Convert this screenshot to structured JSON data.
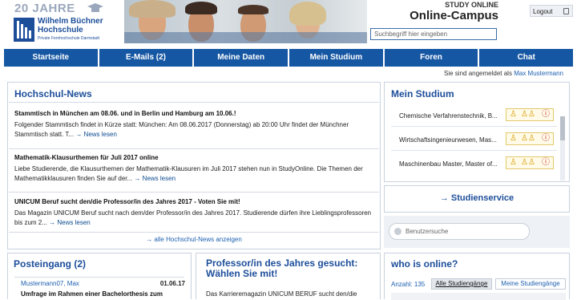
{
  "header": {
    "logo_jahre": "20 JAHRE",
    "logo_name1": "Wilhelm Büchner",
    "logo_name2": "Hochschule",
    "logo_sub": "Private Fernhochschule Darmstadt",
    "study_online": "STUDY ONLINE",
    "campus": "Online-Campus",
    "search_placeholder": "Suchbegriff hier eingeben",
    "logout": "Logout"
  },
  "nav": [
    "Startseite",
    "E-Mails (2)",
    "Meine Daten",
    "Mein Studium",
    "Foren",
    "Chat"
  ],
  "session": {
    "prefix": "Sie sind angemeldet als",
    "user": "Max Mustermann"
  },
  "news": {
    "title": "Hochschul-News",
    "items": [
      {
        "headline": "Stammtisch in München am 08.06. und in Berlin und Hamburg am 10.06.!",
        "text": "Folgender Stammtisch findet in Kürze statt: München: Am 08.06.2017 (Donnerstag) ab 20:00 Uhr findet der Münchner Stammtisch statt. T...",
        "more": "→ News lesen"
      },
      {
        "headline": "Mathematik-Klausurthemen für Juli 2017 online",
        "text": "Liebe Studierende, die Klausurthemen der Mathematik-Klausuren im Juli 2017 stehen nun in StudyOnline. Die Themen der Mathematikklausuren finden Sie auf der...",
        "more": "→ News lesen"
      },
      {
        "headline": "UNICUM Beruf sucht den/die Professor/in des Jahres 2017 - Voten Sie mit!",
        "text": "Das Magazin UNICUM Beruf sucht nach dem/der Professor/in des Jahres 2017. Studierende dürfen ihre Lieblingsprofessoren bis zum 2...",
        "more": "→ News lesen"
      }
    ],
    "all_link": "→ alle Hochschul-News anzeigen"
  },
  "studium": {
    "title": "Mein Studium",
    "courses": [
      "Chemische Verfahrenstechnik, B...",
      "Wirtschaftsingenieurwesen, Mas...",
      "Maschinenbau Master, Master of..."
    ]
  },
  "service": {
    "link": "→ Studienservice"
  },
  "user_search": {
    "placeholder": "Benutzersuche"
  },
  "inbox": {
    "title": "Posteingang (2)",
    "sender": "Mustermann07, Max",
    "date": "01.06.17",
    "subject": "Umfrage im Rahmen einer Bachelorthesis zum"
  },
  "prof": {
    "title": "Professor/in des Jahres gesucht: Wählen Sie mit!",
    "text": "Das  Karrieremagazin UNICUM BERUF sucht den/die"
  },
  "online": {
    "title": "who is online?",
    "count": "Anzahl: 135",
    "tab_all": "Alle Studiengänge",
    "tab_mine": "Meine Studiengänge"
  },
  "colors": {
    "nav_blue": "#1657a3",
    "title_blue": "#1d4e9a",
    "link_blue": "#1d5fb0",
    "warning_icon": "#d89a00",
    "info_icon": "#c62020"
  }
}
